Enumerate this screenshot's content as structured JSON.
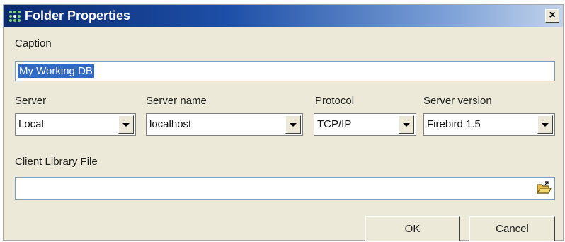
{
  "window": {
    "title": "Folder Properties",
    "close_glyph": "×",
    "title_icon": "grid-dots-icon"
  },
  "caption": {
    "label": "Caption",
    "value": "My Working DB"
  },
  "server": {
    "label": "Server",
    "value": "Local"
  },
  "server_name": {
    "label": "Server name",
    "value": "localhost"
  },
  "protocol": {
    "label": "Protocol",
    "value": "TCP/IP"
  },
  "server_version": {
    "label": "Server version",
    "value": "Firebird 1.5"
  },
  "client_library": {
    "label": "Client Library File",
    "value": "",
    "browse_icon": "open-folder-icon"
  },
  "buttons": {
    "ok": "OK",
    "cancel": "Cancel"
  },
  "colors": {
    "title_gradient_start": "#0b2a6f",
    "title_gradient_end": "#c3d3ea",
    "dialog_bg": "#ece9d8",
    "selection": "#316ac5"
  }
}
